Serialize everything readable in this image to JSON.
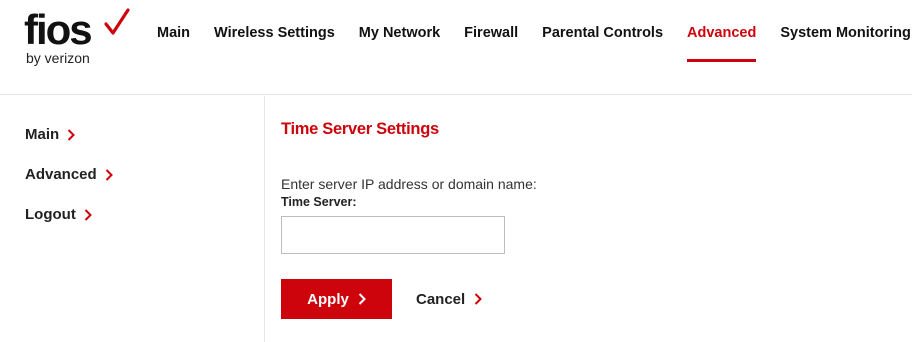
{
  "brand": {
    "logo_word": "fios",
    "logo_sub": "by verizon",
    "accent_color": "#cd040b"
  },
  "topnav": {
    "items": [
      {
        "label": "Main"
      },
      {
        "label": "Wireless Settings"
      },
      {
        "label": "My Network"
      },
      {
        "label": "Firewall"
      },
      {
        "label": "Parental Controls"
      },
      {
        "label": "Advanced"
      },
      {
        "label": "System Monitoring"
      }
    ],
    "active": "Advanced"
  },
  "sidebar": {
    "items": [
      {
        "label": "Main",
        "icon": "chevron-right-icon"
      },
      {
        "label": "Advanced",
        "icon": "chevron-right-icon"
      },
      {
        "label": "Logout",
        "icon": "chevron-right-icon"
      }
    ]
  },
  "main": {
    "title": "Time Server Settings",
    "instruction": "Enter server IP address or domain name:",
    "field_label": "Time Server:",
    "field_value": "",
    "apply_label": "Apply",
    "cancel_label": "Cancel"
  }
}
